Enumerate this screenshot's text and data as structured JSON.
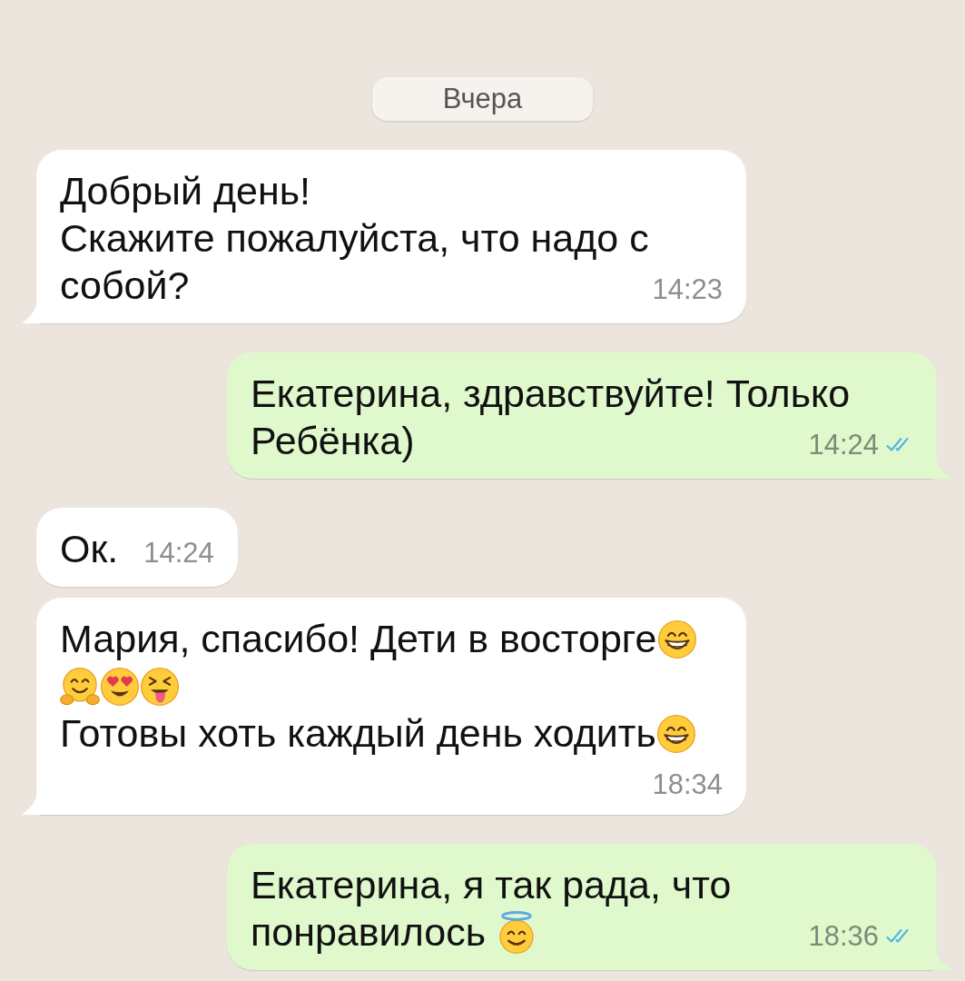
{
  "date_separator": {
    "label": "Вчера"
  },
  "messages": [
    {
      "kind": "incoming",
      "tail": true,
      "content": [
        {
          "kind": "text",
          "text": "Добрый день!\nСкажите пожалуйста, что надо с собой?"
        }
      ],
      "time": "14:23"
    },
    {
      "kind": "outgoing",
      "tail": true,
      "content": [
        {
          "kind": "text",
          "text": "Екатерина, здравствуйте! Только"
        },
        {
          "kind": "break"
        },
        {
          "kind": "text",
          "text": "Ребёнка)"
        }
      ],
      "time": "14:24",
      "read": true
    },
    {
      "kind": "incoming",
      "tail": false,
      "content": [
        {
          "kind": "text",
          "text": "Ок."
        }
      ],
      "time": "14:24"
    },
    {
      "kind": "incoming",
      "tail": true,
      "content": [
        {
          "kind": "text",
          "text": "Мария, спасибо! Дети в восторге"
        },
        {
          "kind": "grinning"
        },
        {
          "kind": "hugging"
        },
        {
          "kind": "hearteyes"
        },
        {
          "kind": "tongue"
        },
        {
          "kind": "break"
        },
        {
          "kind": "text",
          "text": "Готовы хоть каждый день ходить"
        },
        {
          "kind": "grinning"
        }
      ],
      "time": "18:34"
    },
    {
      "kind": "outgoing",
      "tail": true,
      "content": [
        {
          "kind": "text",
          "text": "Екатерина, я так рада, что"
        },
        {
          "kind": "break"
        },
        {
          "kind": "text",
          "text": "понравилось "
        },
        {
          "kind": "halo"
        }
      ],
      "time": "18:36",
      "read": true
    }
  ]
}
